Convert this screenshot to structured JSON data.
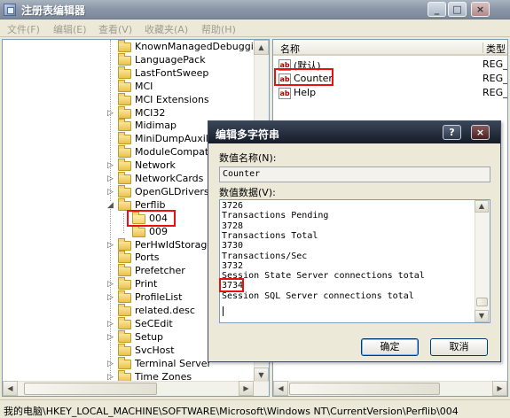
{
  "window": {
    "title": "注册表编辑器"
  },
  "titlebar_buttons": {
    "minimize": "_",
    "maximize": "□",
    "close": "×"
  },
  "menu": [
    "文件(F)",
    "编辑(E)",
    "查看(V)",
    "收藏夹(A)",
    "帮助(H)"
  ],
  "tree": {
    "items": [
      {
        "label": "KnownManagedDebugging",
        "expander": ""
      },
      {
        "label": "LanguagePack",
        "expander": ""
      },
      {
        "label": "LastFontSweep",
        "expander": ""
      },
      {
        "label": "MCI",
        "expander": ""
      },
      {
        "label": "MCI Extensions",
        "expander": ""
      },
      {
        "label": "MCI32",
        "expander": "▷"
      },
      {
        "label": "Midimap",
        "expander": ""
      },
      {
        "label": "MiniDumpAuxiliar",
        "expander": ""
      },
      {
        "label": "ModuleCompatib",
        "expander": ""
      },
      {
        "label": "Network",
        "expander": "▷"
      },
      {
        "label": "NetworkCards",
        "expander": "▷"
      },
      {
        "label": "OpenGLDrivers",
        "expander": "▷"
      },
      {
        "label": "Perflib",
        "expander": "◢"
      },
      {
        "label": "004",
        "expander": "",
        "child": true,
        "open": true
      },
      {
        "label": "009",
        "expander": "",
        "child": true
      },
      {
        "label": "PerHwIdStorage",
        "expander": "▷"
      },
      {
        "label": "Ports",
        "expander": ""
      },
      {
        "label": "Prefetcher",
        "expander": ""
      },
      {
        "label": "Print",
        "expander": "▷"
      },
      {
        "label": "ProfileList",
        "expander": "▷"
      },
      {
        "label": "related.desc",
        "expander": ""
      },
      {
        "label": "SeCEdit",
        "expander": "▷"
      },
      {
        "label": "Setup",
        "expander": "▷"
      },
      {
        "label": "SvcHost",
        "expander": ""
      },
      {
        "label": "Terminal Server",
        "expander": "▷"
      },
      {
        "label": "Time Zones",
        "expander": "▷"
      }
    ]
  },
  "list": {
    "columns": [
      "名称",
      "类型"
    ],
    "rows": [
      {
        "icon": "ab",
        "name": "(默认)",
        "type": "REG_"
      },
      {
        "icon": "ab",
        "name": "Counter",
        "type": "REG_"
      },
      {
        "icon": "ab",
        "name": "Help",
        "type": "REG_"
      }
    ]
  },
  "statusbar": {
    "path": "我的电脑\\HKEY_LOCAL_MACHINE\\SOFTWARE\\Microsoft\\Windows NT\\CurrentVersion\\Perflib\\004"
  },
  "dialog": {
    "title": "编辑多字符串",
    "help_button": "?",
    "close_button": "×",
    "name_label": "数值名称(N):",
    "name_value": "Counter",
    "data_label": "数值数据(V):",
    "lines": [
      "3726",
      "Transactions Pending",
      "3728",
      "Transactions Total",
      "3730",
      "Transactions/Sec",
      "3732",
      "Session State Server connections total",
      "3734",
      "Session SQL Server connections total"
    ],
    "ok_label": "确定",
    "cancel_label": "取消"
  },
  "colors": {
    "highlight": "#e81010",
    "dialog_title": "#151c28",
    "tree_border": "#7f9db9"
  }
}
